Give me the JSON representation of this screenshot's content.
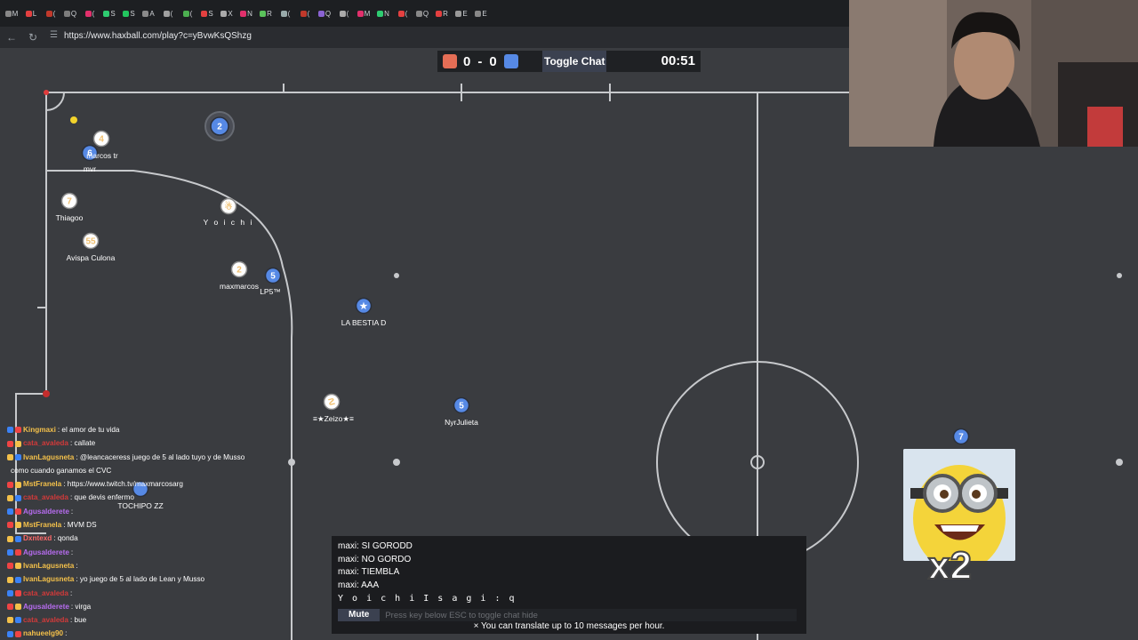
{
  "browser": {
    "url": "https://www.haxball.com/play?c=yBvwKsQShzg",
    "tab_letters": [
      "M",
      "L",
      "(",
      "Q",
      "(",
      "S",
      "S",
      "A",
      "(",
      "(",
      "S",
      "X",
      "N",
      "R",
      "(",
      "(",
      "Q",
      "(",
      "M",
      "N",
      "(",
      "Q",
      "R",
      "E",
      "E"
    ]
  },
  "scoreboard": {
    "red_score": "0",
    "separator": "-",
    "blue_score": "0",
    "toggle_chat_label": "Toggle Chat",
    "timer": "00:51",
    "red_color": "#e56e56",
    "blue_color": "#5689e5"
  },
  "players": [
    {
      "name": "marcos tr",
      "number": "6",
      "team": "blue"
    },
    {
      "name": "mvr",
      "number": "4",
      "team": "red"
    },
    {
      "name": "Thiagoo",
      "number": "7",
      "team": "red"
    },
    {
      "name": "Avispa Culona",
      "number": "55",
      "team": "red"
    },
    {
      "name": "Y o i c h i",
      "number": "☃",
      "team": "red"
    },
    {
      "name": "maxmarcos",
      "number": "2",
      "team": "red"
    },
    {
      "name": "LP5™",
      "number": "5",
      "team": "blue"
    },
    {
      "name": "LA BESTIA D",
      "number": "★",
      "team": "blue"
    },
    {
      "name": "≡★Zeizo★≡",
      "number": "☡",
      "team": "red"
    },
    {
      "name": "NyrJulieta",
      "number": "5",
      "team": "blue"
    },
    {
      "name": "TOCHIPO ZZ",
      "number": "",
      "team": "blue"
    },
    {
      "name": "",
      "number": "2",
      "team": "blue"
    },
    {
      "name": "",
      "number": "7",
      "team": "blue"
    }
  ],
  "stream_chat": [
    {
      "user": "Kingmaxi",
      "text": ": el amor de tu vida",
      "color": "#f3c04a"
    },
    {
      "user": "cata_avaleda",
      "text": ": callate",
      "color": "#d23a3a"
    },
    {
      "user": "IvanLagusneta",
      "text": ": @leancaceress juego de 5 al lado tuyo y de Musso",
      "color": "#f3c04a"
    },
    {
      "user": "",
      "text": "como cuando ganamos el CVC",
      "color": "#ffffff"
    },
    {
      "user": "MstFranela",
      "text": ": https://www.twitch.tv/maxmarcosarg",
      "color": "#f3c04a"
    },
    {
      "user": "cata_avaleda",
      "text": ": que devis enfermo",
      "color": "#d23a3a"
    },
    {
      "user": "Agusalderete",
      "text": ":",
      "color": "#b76cf0"
    },
    {
      "user": "MstFranela",
      "text": ": MVM DS",
      "color": "#f3c04a"
    },
    {
      "user": "Dxntexd",
      "text": ": qonda",
      "color": "#ff6a6a"
    },
    {
      "user": "Agusalderete",
      "text": ":",
      "color": "#b76cf0"
    },
    {
      "user": "IvanLagusneta",
      "text": ":",
      "color": "#f3c04a"
    },
    {
      "user": "IvanLagusneta",
      "text": ": yo juego de 5 al lado de Lean y Musso",
      "color": "#f3c04a"
    },
    {
      "user": "cata_avaleda",
      "text": ":",
      "color": "#d23a3a"
    },
    {
      "user": "Agusalderete",
      "text": ": virga",
      "color": "#b76cf0"
    },
    {
      "user": "cata_avaleda",
      "text": ": bue",
      "color": "#d23a3a"
    },
    {
      "user": "nahueelg90",
      "text": ":",
      "color": "#f3c04a"
    }
  ],
  "game_chat": {
    "messages": [
      "maxi: SI GORODD",
      "maxi: NO GORDO",
      "maxi: TIEMBLA",
      "maxi: AAA",
      "Y o i c h i  I s a g i : q"
    ],
    "mute_label": "Mute",
    "input_placeholder": "Press key below ESC to toggle chat hide",
    "translate_notice": "× You can translate up to 10 messages per hour."
  },
  "overlay": {
    "emote_text": "x2",
    "emote_player_number": "7"
  }
}
